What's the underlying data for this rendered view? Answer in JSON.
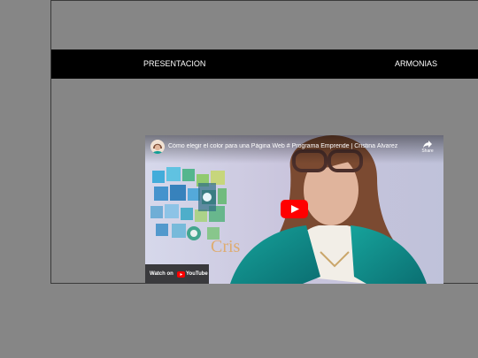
{
  "nav": {
    "left_link": "PRESENTACION",
    "right_link": "ARMONIAS"
  },
  "video": {
    "title": "Cómo elegir el color para una Página Web # Programa Emprende | Cristina Álvarez",
    "share_label": "Share",
    "watch_on_label": "Watch on",
    "youtube_label": "YouTube"
  },
  "colors": {
    "page_background": "#868686",
    "navbar_background": "#000000",
    "nav_text": "#ffffff",
    "play_button_red": "#ff0000",
    "jacket_teal": "#0f8a86"
  },
  "icons": {
    "share": "share-icon",
    "play": "youtube-play-icon",
    "youtube_logo": "youtube-logo-icon"
  }
}
